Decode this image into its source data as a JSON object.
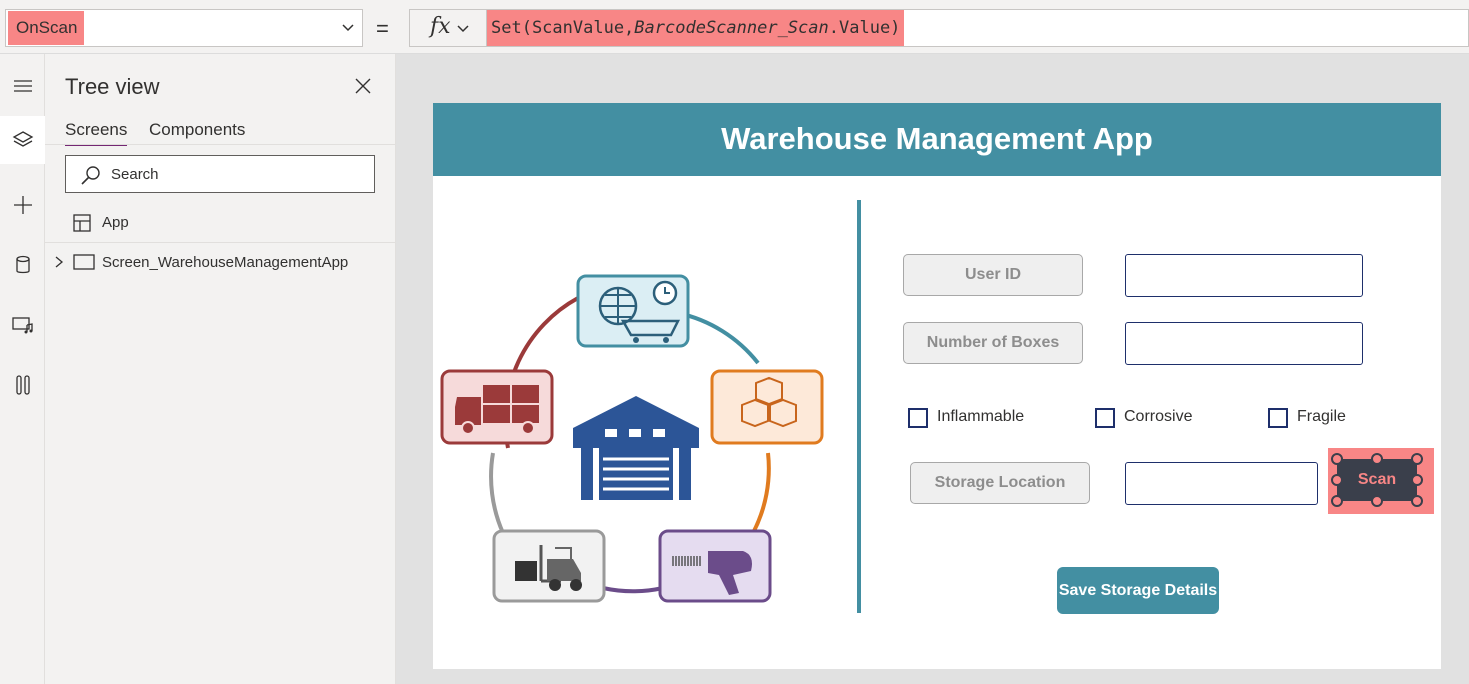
{
  "toolbar": {
    "property_name": "OnScan",
    "property_value": "",
    "equals": "=",
    "fx_label": "fx",
    "formula_parts": [
      "Set(ScanValue,",
      "BarcodeScanner_Scan",
      ".Value)"
    ]
  },
  "rail": {
    "icons": [
      "hamburger-icon",
      "layers-icon",
      "plus-icon",
      "database-icon",
      "media-icon",
      "tools-icon"
    ]
  },
  "tree_view": {
    "title": "Tree view",
    "tabs": [
      {
        "label": "Screens",
        "active": true
      },
      {
        "label": "Components",
        "active": false
      }
    ],
    "search_placeholder": "Search",
    "items": [
      {
        "label": "App",
        "icon": "app-icon"
      },
      {
        "label": "Screen_WarehouseManagementApp",
        "icon": "screen-icon"
      }
    ]
  },
  "app": {
    "title": "Warehouse Management App",
    "fields": {
      "user_id_label": "User ID",
      "boxes_label": "Number of Boxes",
      "storage_label": "Storage Location"
    },
    "checkboxes": [
      {
        "label": "Inflammable",
        "checked": false
      },
      {
        "label": "Corrosive",
        "checked": false
      },
      {
        "label": "Fragile",
        "checked": false
      }
    ],
    "scan_label": "Scan",
    "save_label": "Save Storage Details"
  },
  "colors": {
    "accent": "#438fa2",
    "highlight": "#f88686",
    "input_border": "#1e2f6b"
  }
}
